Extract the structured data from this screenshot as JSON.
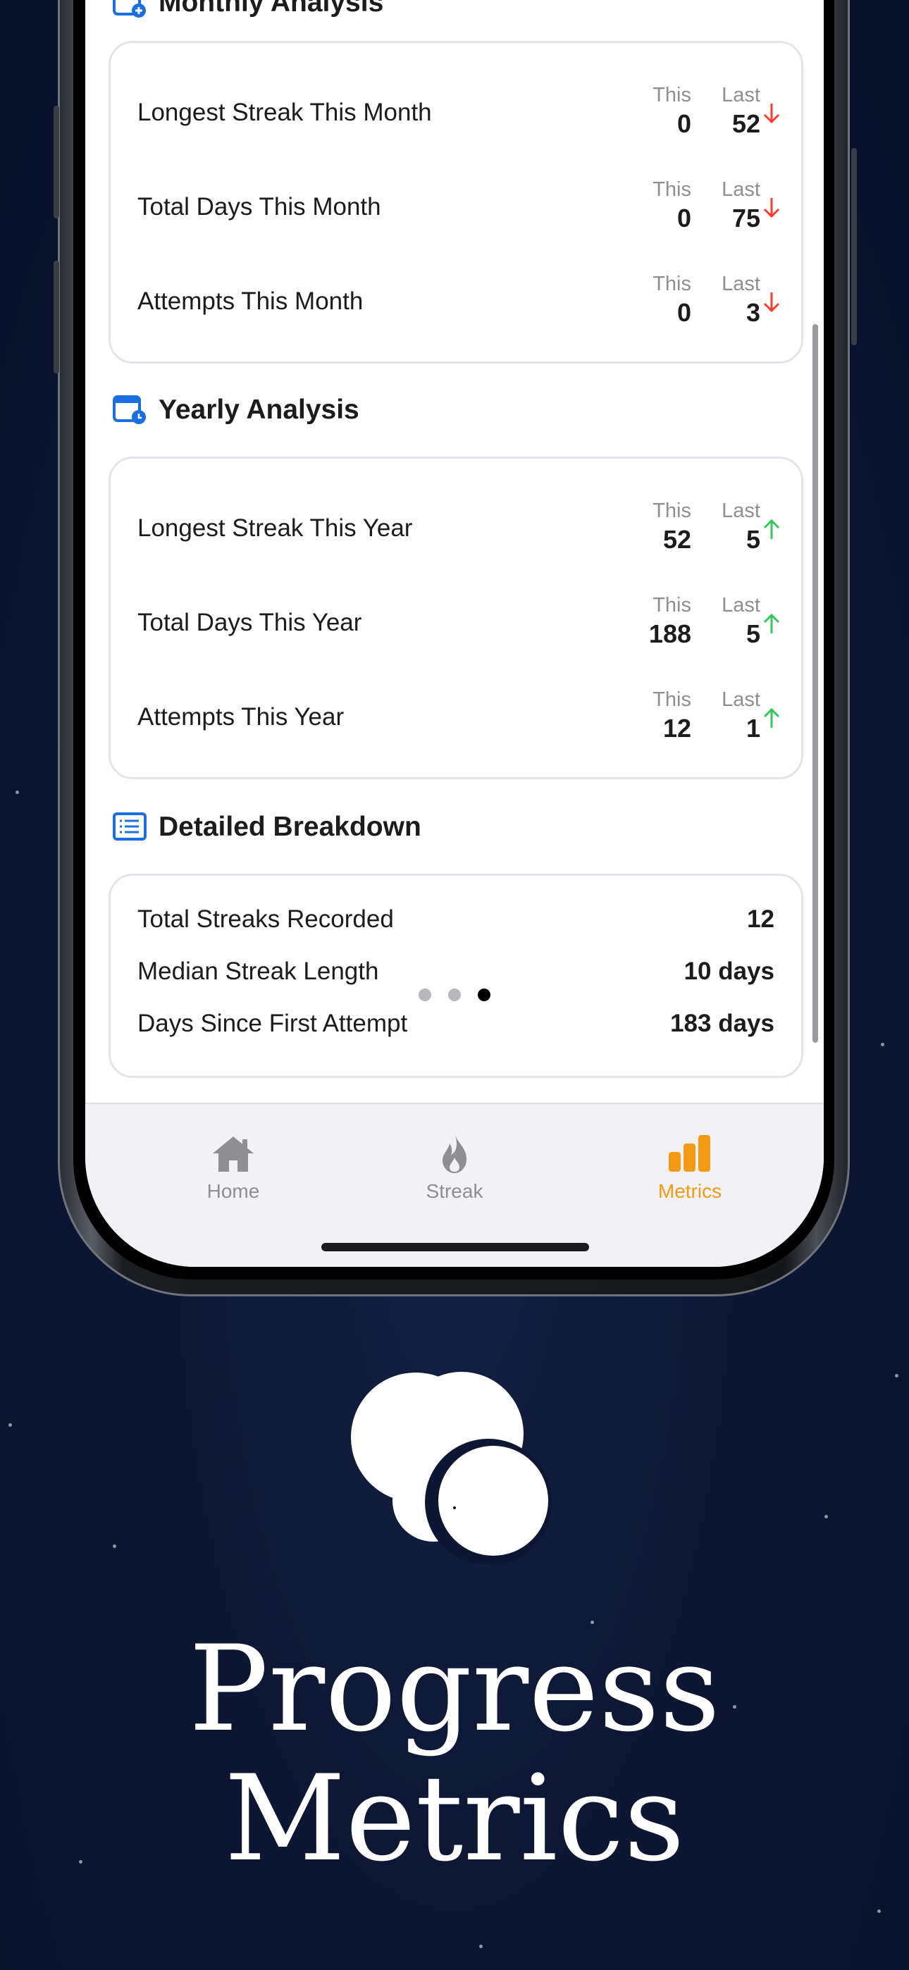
{
  "monthly": {
    "title": "Monthly Analysis",
    "rows": [
      {
        "label": "Longest Streak This Month",
        "this_cap": "This",
        "this": "0",
        "last_cap": "Last",
        "last": "52",
        "trend": "down"
      },
      {
        "label": "Total Days This Month",
        "this_cap": "This",
        "this": "0",
        "last_cap": "Last",
        "last": "75",
        "trend": "down"
      },
      {
        "label": "Attempts This Month",
        "this_cap": "This",
        "this": "0",
        "last_cap": "Last",
        "last": "3",
        "trend": "down"
      }
    ]
  },
  "yearly": {
    "title": "Yearly Analysis",
    "rows": [
      {
        "label": "Longest Streak This Year",
        "this_cap": "This",
        "this": "52",
        "last_cap": "Last",
        "last": "5",
        "trend": "up"
      },
      {
        "label": "Total Days This Year",
        "this_cap": "This",
        "this": "188",
        "last_cap": "Last",
        "last": "5",
        "trend": "up"
      },
      {
        "label": "Attempts This Year",
        "this_cap": "This",
        "this": "12",
        "last_cap": "Last",
        "last": "1",
        "trend": "up"
      }
    ]
  },
  "breakdown": {
    "title": "Detailed Breakdown",
    "rows": [
      {
        "label": "Total Streaks Recorded",
        "value": "12"
      },
      {
        "label": "Median Streak Length",
        "value": "10 days"
      },
      {
        "label": "Days Since First Attempt",
        "value": "183 days"
      }
    ],
    "page_dots": 3,
    "active_page": 3
  },
  "tabs": [
    {
      "label": "Home",
      "icon": "house-icon",
      "active": false
    },
    {
      "label": "Streak",
      "icon": "flame-icon",
      "active": false
    },
    {
      "label": "Metrics",
      "icon": "bar-chart-icon",
      "active": true
    }
  ],
  "headline": {
    "line1": "Progress",
    "line2": "Metrics"
  },
  "colors": {
    "accent": "#f39a14",
    "down": "#ff3b30",
    "up": "#34c759",
    "section_icon": "#1a6fe0",
    "background": "#0d1733"
  }
}
